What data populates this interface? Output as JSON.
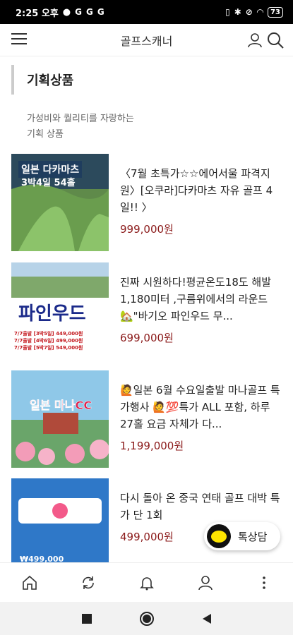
{
  "status": {
    "time": "2:25 오후",
    "left_icons": [
      "G",
      "G",
      "G"
    ],
    "battery": "73"
  },
  "appbar": {
    "title": "골프스캐너"
  },
  "section": {
    "title": "기획상품",
    "subtitle_line1": "가성비와 퀄리티를 자랑하는",
    "subtitle_line2": "기획 상품"
  },
  "products": [
    {
      "name": "〈7월 초특가☆☆에어서울 파격지원〉[오쿠라]다카마츠 자유 골프 4일!! 〉",
      "price": "999,000원",
      "thumb_title": "일본 다카마츠",
      "thumb_sub": "3박4일 54홀"
    },
    {
      "name": "진짜 시원하다!평균온도18도 해발1,180미터 ,구름위에서의 라운드 🏡\"바기오 파인우드 무...",
      "price": "699,000원",
      "thumb_title": "파인우드",
      "thumb_lines": [
        "7/7출발 [3박5일] 449,000원",
        "7/7출발 [4박6일] 499,000원",
        "7/7출발 [5박7일] 549,000원"
      ]
    },
    {
      "name": "🙋일본 6월 수요일출발 마나골프 특가행사 🙋💯특가 ALL 포함, 하루 27홀 요금 자체가 다...",
      "price": "1,199,000원",
      "thumb_title": "일본 마나CC"
    },
    {
      "name": "다시 돌아 온 중국 연태 골프 대박 특가 단 1회",
      "price": "499,000원",
      "thumb_price": "₩499,000"
    }
  ],
  "chat": {
    "label": "톡상담"
  }
}
